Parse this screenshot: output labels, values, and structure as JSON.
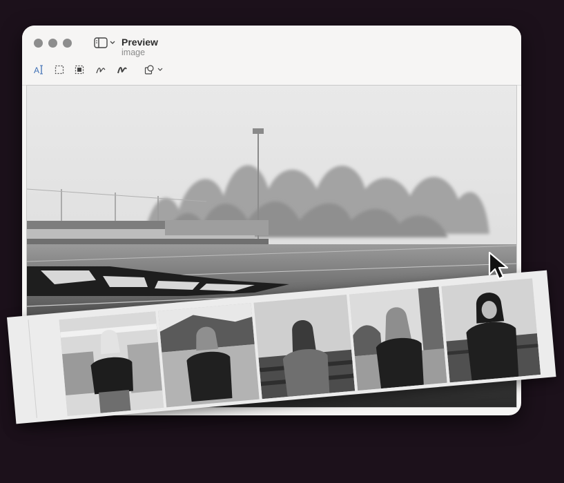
{
  "window": {
    "title": "Preview",
    "subtitle": "image"
  },
  "toolbar": {
    "tools": [
      {
        "name": "text-selection-icon"
      },
      {
        "name": "rectangular-selection-icon"
      },
      {
        "name": "instant-alpha-icon"
      },
      {
        "name": "sketch-icon"
      },
      {
        "name": "draw-icon"
      },
      {
        "name": "shapes-icon"
      }
    ]
  },
  "canvas": {
    "photo": "foggy-football-stadium",
    "filmstrip": [
      {
        "name": "photo-girl-indoor-room"
      },
      {
        "name": "photo-girl-hoodie-outdoor"
      },
      {
        "name": "photo-girl-sweater-bleachers"
      },
      {
        "name": "photo-girl-sweater-trees"
      },
      {
        "name": "photo-person-hoodie"
      }
    ]
  },
  "colors": {
    "background": "#1c111b",
    "window": "#f6f5f4",
    "icon": "#3d6fb5"
  }
}
